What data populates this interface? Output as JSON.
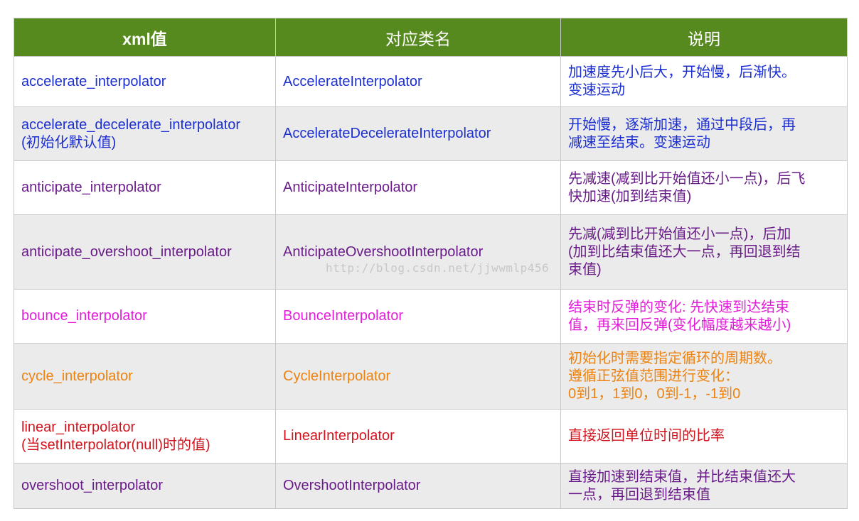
{
  "table": {
    "headers": [
      "xml值",
      "对应类名",
      "说明"
    ],
    "rows": [
      {
        "xml": "accelerate_interpolator",
        "xml_note": "",
        "class_name": "AccelerateInterpolator",
        "desc": "加速度先小后大，开始慢，后渐快。\n变速运动",
        "color": "#1c2fd0"
      },
      {
        "xml": "accelerate_decelerate_interpolator",
        "xml_note": "(初始化默认值)",
        "class_name": "AccelerateDecelerateInterpolator",
        "desc": "开始慢，逐渐加速，通过中段后，再\n减速至结束。变速运动",
        "color": "#1c2fd0"
      },
      {
        "xml": "anticipate_interpolator",
        "xml_note": "",
        "class_name": "AnticipateInterpolator",
        "desc": "先减速(减到比开始值还小一点)，后飞\n快加速(加到结束值)",
        "color": "#6a1b8a"
      },
      {
        "xml": "anticipate_overshoot_interpolator",
        "xml_note": "",
        "class_name": "AnticipateOvershootInterpolator",
        "desc": "先减(减到比开始值还小一点)，后加\n(加到比结束值还大一点，再回退到结\n束值)",
        "color": "#6a1b8a"
      },
      {
        "xml": "bounce_interpolator",
        "xml_note": "",
        "class_name": "BounceInterpolator",
        "desc": "结束时反弹的变化: 先快速到达结束\n值，再来回反弹(变化幅度越来越小)",
        "color": "#e21fd8"
      },
      {
        "xml": "cycle_interpolator",
        "xml_note": "",
        "class_name": "CycleInterpolator",
        "desc": "初始化时需要指定循环的周期数。\n遵循正弦值范围进行变化：\n0到1，1到0，0到-1，-1到0",
        "color": "#ec8311"
      },
      {
        "xml": "linear_interpolator",
        "xml_note": "(当setInterpolator(null)时的值)",
        "class_name": "LinearInterpolator",
        "desc": "直接返回单位时间的比率",
        "color": "#d2141e"
      },
      {
        "xml": "overshoot_interpolator",
        "xml_note": "",
        "class_name": "OvershootInterpolator",
        "desc": "直接加速到结束值，并比结束值还大\n一点，再回退到结束值",
        "color": "#6a1b8a"
      }
    ]
  },
  "watermark": "http://blog.csdn.net/jjwwmlp456",
  "colors": {
    "header_bg": "#568a1e",
    "row_alt_bg": "#ebebeb",
    "border": "#c8c8c8"
  }
}
